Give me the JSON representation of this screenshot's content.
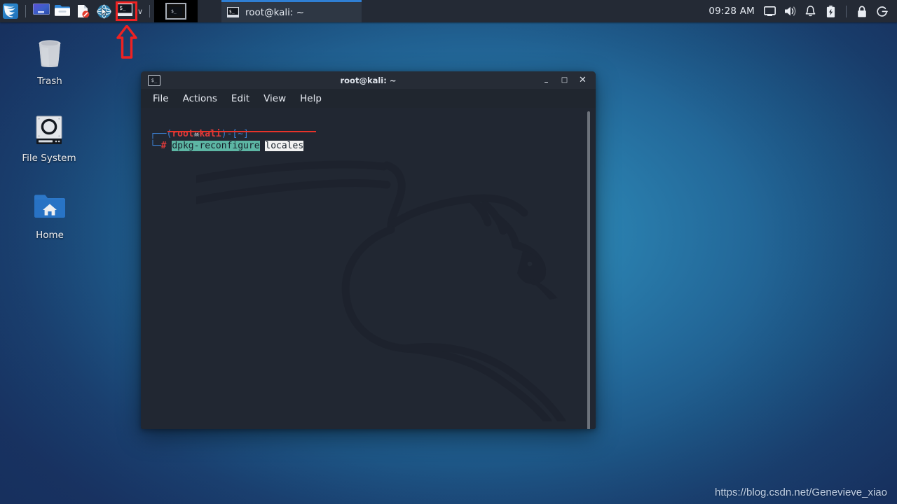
{
  "panel": {
    "launchers": [
      {
        "name": "kali-menu",
        "icon": "kali-dragon-icon",
        "title": "Applications"
      },
      {
        "name": "workspace-switcher",
        "icon": "workspace-icon",
        "title": "Workspaces"
      },
      {
        "name": "file-manager",
        "icon": "folder-icon",
        "title": "File Manager"
      },
      {
        "name": "text-editor",
        "icon": "document-forbidden-icon",
        "title": "Text Editor"
      },
      {
        "name": "web-browser",
        "icon": "globe-cursor-icon",
        "title": "Web Browser"
      },
      {
        "name": "terminal",
        "icon": "terminal-icon",
        "title": "Terminal Emulator"
      }
    ],
    "chevron": "∨",
    "pager_icon": "terminal-window-icon",
    "taskbar_button": {
      "icon": "terminal-icon",
      "label": "root@kali: ~"
    },
    "tray": {
      "clock": "09:28 AM",
      "items": [
        {
          "name": "display-icon",
          "glyph": "display"
        },
        {
          "name": "volume-icon",
          "glyph": "speaker"
        },
        {
          "name": "notification-bell-icon",
          "glyph": "bell"
        },
        {
          "name": "battery-icon",
          "glyph": "battery"
        },
        {
          "name": "lock-screen-icon",
          "glyph": "padlock"
        },
        {
          "name": "logout-icon",
          "glyph": "power-exit"
        }
      ]
    }
  },
  "desktop": {
    "icons": [
      {
        "name": "trash",
        "label": "Trash",
        "icon": "trash-icon"
      },
      {
        "name": "file-system",
        "label": "File System",
        "icon": "harddisk-icon"
      },
      {
        "name": "home",
        "label": "Home",
        "icon": "home-folder-icon"
      }
    ],
    "watermark": "https://blog.csdn.net/Genevieve_xiao"
  },
  "terminal": {
    "title": "root@kali: ~",
    "titlebar_icon": "terminal-icon",
    "window_buttons": {
      "minimize": "–",
      "maximize": "□",
      "close": "✕"
    },
    "menu": [
      "File",
      "Actions",
      "Edit",
      "View",
      "Help"
    ],
    "prompt": {
      "line1_branch": "┌──",
      "line1_open_paren": "(",
      "line1_user": "root",
      "line1_skull": "☠",
      "line1_host": "kali",
      "line1_close_paren": ")-[",
      "line1_path": "~",
      "line1_end": "]",
      "line2_branch": "└─",
      "line2_symbol": "#",
      "command": "dpkg-reconfigure",
      "argument": "locales"
    }
  },
  "annotations": {
    "highlight_box_target": "terminal-launcher",
    "arrow_direction": "up",
    "color": "#ee2222"
  },
  "colors": {
    "panel_bg": "#242a35",
    "terminal_bg": "#212732",
    "accent_blue": "#2f7fd4",
    "prompt_red": "#e03a3a",
    "cmd_highlight": "#5db6a4",
    "annotation_red": "#ee2222"
  }
}
